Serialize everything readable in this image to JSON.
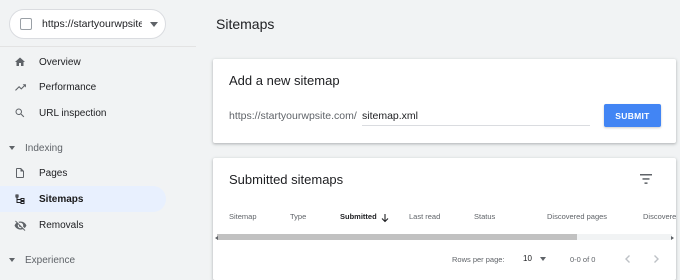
{
  "property": {
    "label": "https://startyourwpsite.com/"
  },
  "nav": {
    "overview": "Overview",
    "performance": "Performance",
    "url_inspection": "URL inspection",
    "indexing_section": "Indexing",
    "pages": "Pages",
    "sitemaps": "Sitemaps",
    "removals": "Removals",
    "experience_section": "Experience"
  },
  "page_title": "Sitemaps",
  "add_sitemap": {
    "title": "Add a new sitemap",
    "url_prefix": "https://startyourwpsite.com/",
    "input_value": "sitemap.xml",
    "submit_label": "SUBMIT"
  },
  "submitted": {
    "title": "Submitted sitemaps",
    "columns": [
      "Sitemap",
      "Type",
      "Submitted",
      "Last read",
      "Status",
      "Discovered pages",
      "Discovered videos"
    ],
    "sorted_column": "Submitted",
    "rows_per_page_label": "Rows per page:",
    "rows_per_page_value": "10",
    "range_label": "0-0 of 0"
  },
  "colors": {
    "accent": "#4285f4",
    "active_nav_bg": "#e8f0fe"
  }
}
